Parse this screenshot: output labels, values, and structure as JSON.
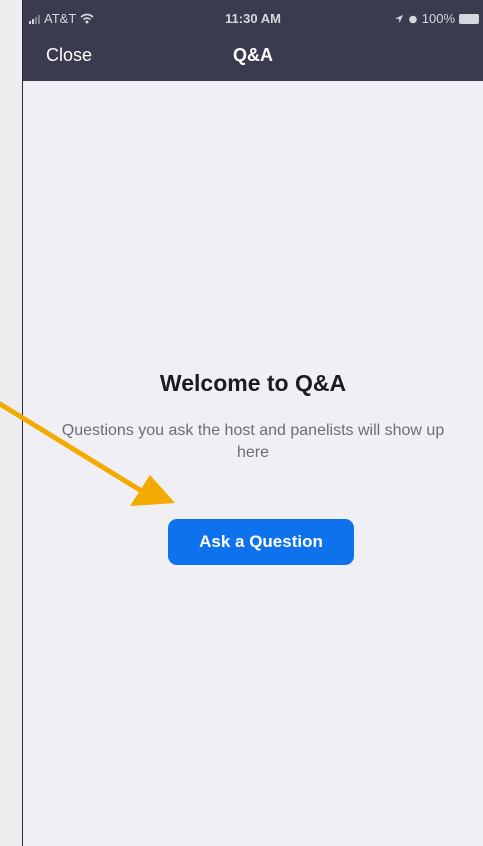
{
  "status_bar": {
    "carrier": "AT&T",
    "time": "11:30 AM",
    "battery": "100%"
  },
  "nav": {
    "close_label": "Close",
    "title": "Q&A"
  },
  "content": {
    "welcome_title": "Welcome to Q&A",
    "welcome_subtitle": "Questions you ask the host and panelists will show up here",
    "ask_button_label": "Ask a Question"
  },
  "colors": {
    "header_bg": "#3b3b4f",
    "screen_bg": "#efeff4",
    "button_blue": "#0e72ed",
    "arrow_orange": "#f2a900"
  }
}
